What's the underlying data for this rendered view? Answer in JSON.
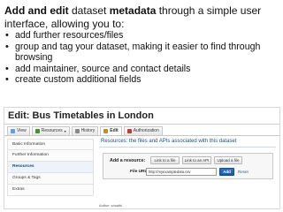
{
  "slide": {
    "intro_bold_1": "Add and edit",
    "intro_text_1": " dataset ",
    "intro_bold_2": "metadata",
    "intro_text_2": " through a simple user interface, allowing you to:",
    "bullets": [
      "add further resources/files",
      "group and tag your dataset, making it easier to find through browsing",
      "add maintainer, source and contact details",
      "create custom additional fields"
    ]
  },
  "screenshot": {
    "title": "Edit: Bus Timetables in London",
    "tabs": [
      {
        "label": "View",
        "icon_color": "#6a9bd8"
      },
      {
        "label": "Resources",
        "icon_color": "#4f8a3a"
      },
      {
        "label": "History",
        "icon_color": "#8a8a8a"
      },
      {
        "label": "Edit",
        "icon_color": "#c48b2a"
      },
      {
        "label": "Authorization",
        "icon_color": "#b04040"
      }
    ],
    "sidebar": [
      "Basic Information",
      "Further Information",
      "Resources",
      "Groups & Tags",
      "Extras"
    ],
    "active_sidebar": "Resources",
    "section_heading": "Resources: the files and APIs associated with this dataset",
    "add_resource_label": "Add a resource:",
    "buttons": [
      "Link to a file",
      "Link to an API",
      "Upload a file"
    ],
    "file_url_label": "File URL",
    "file_url_value": "http://myexampledata.csv",
    "add_button": "Add",
    "reset_link": "Reset",
    "footnote": "Author: shoaibi"
  }
}
